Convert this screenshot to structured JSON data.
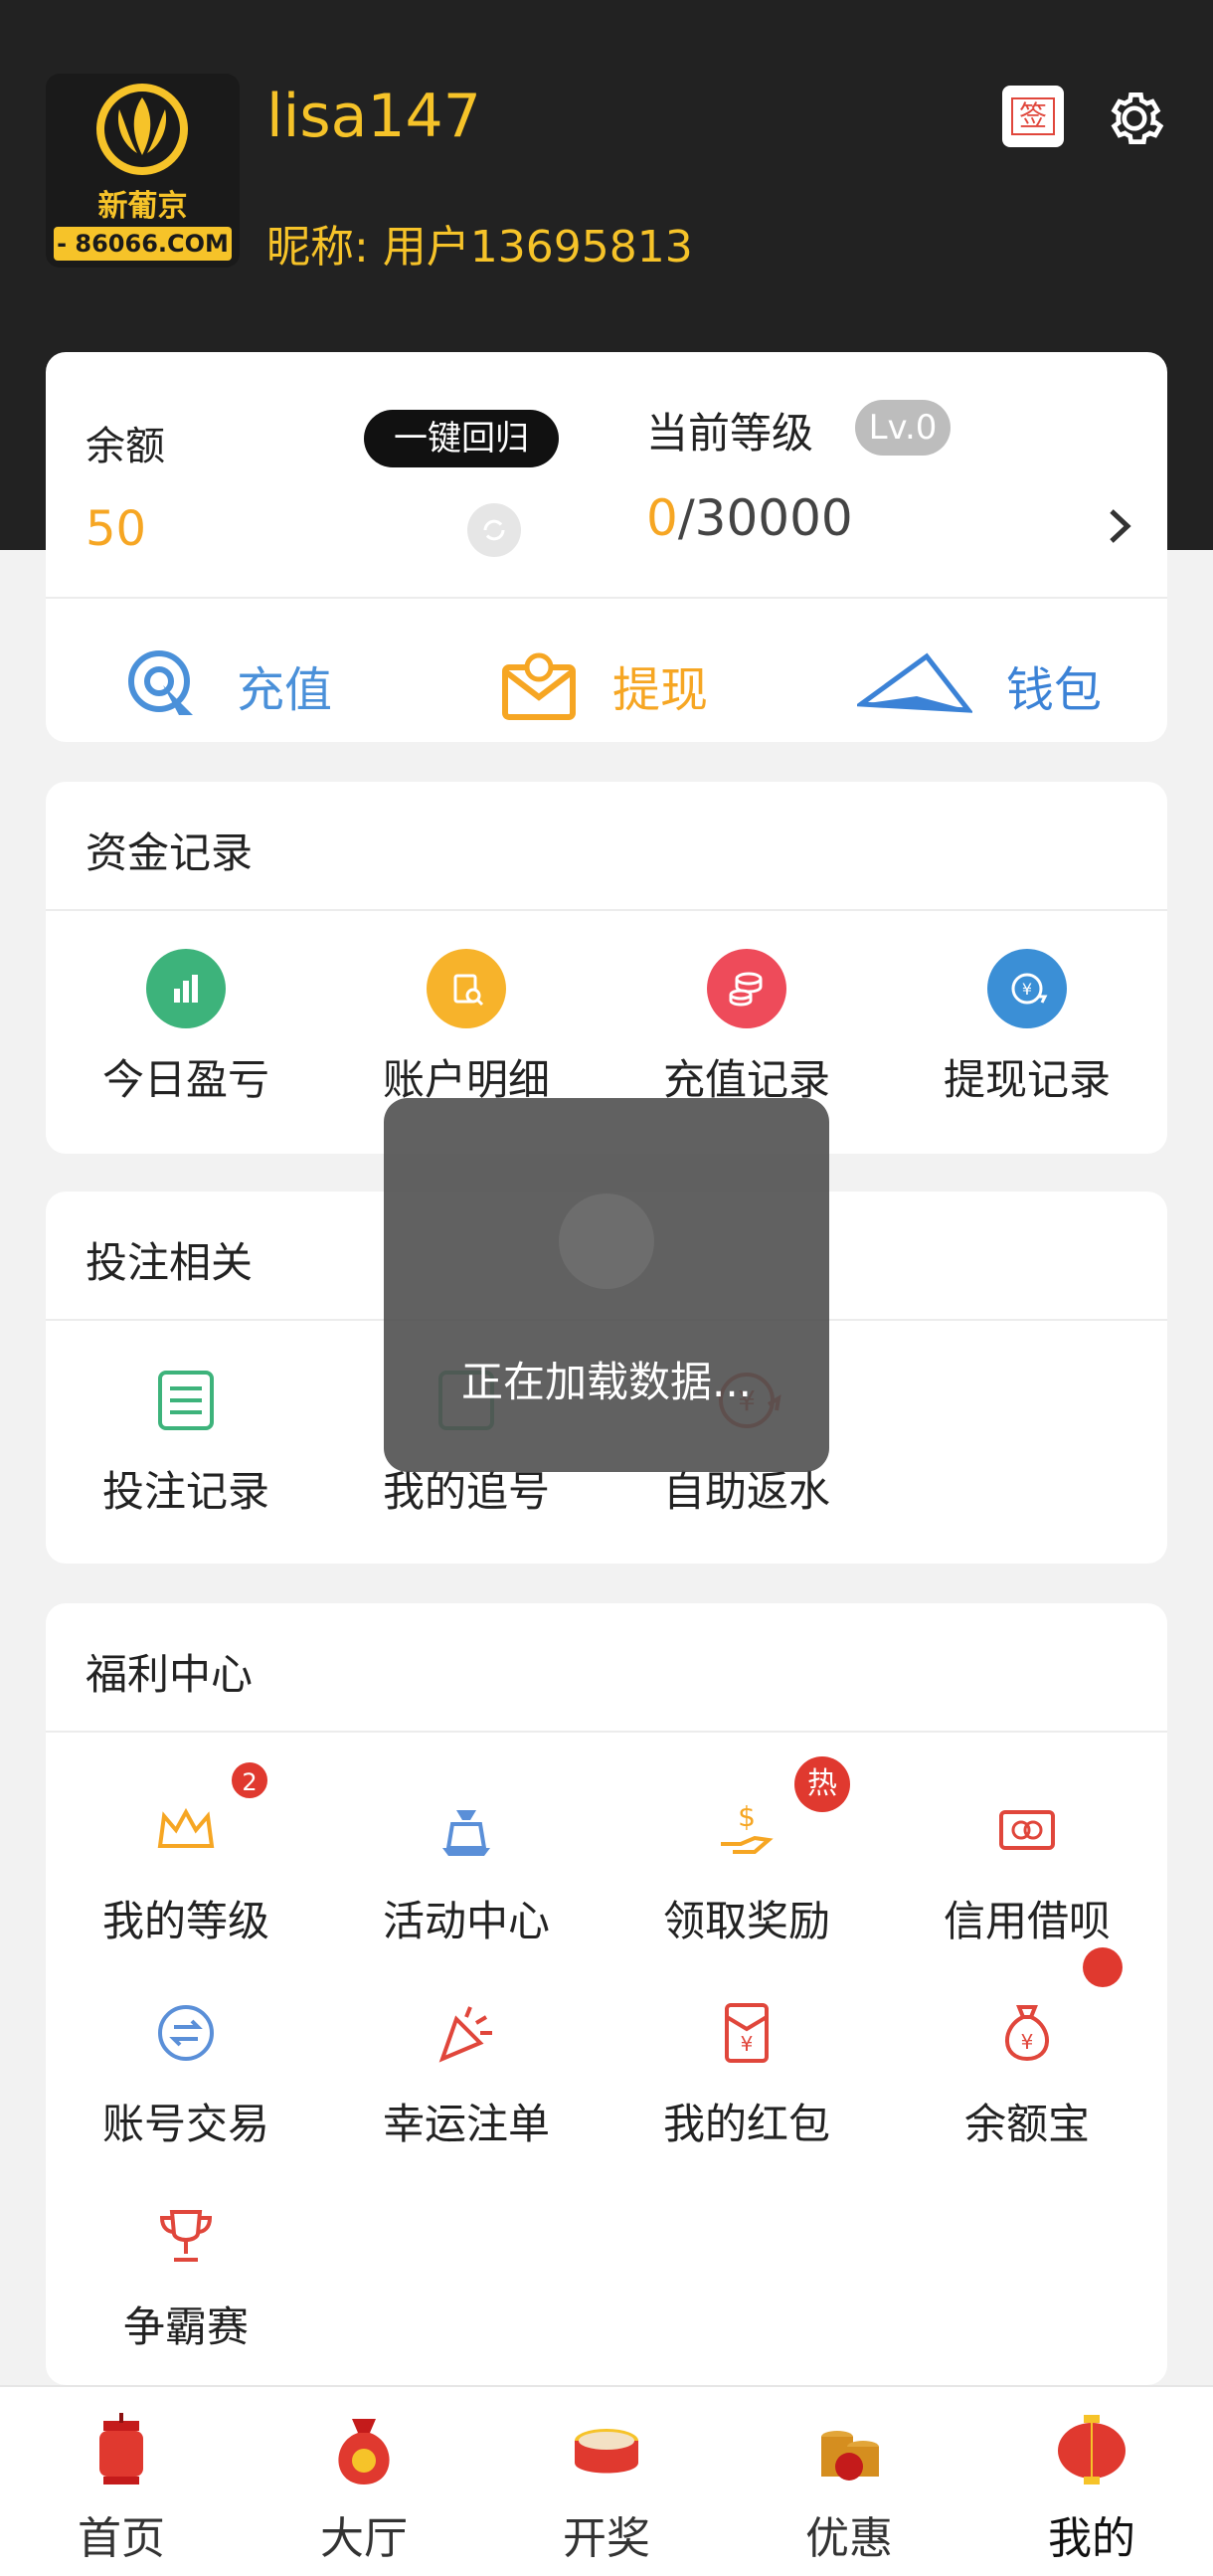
{
  "header": {
    "logo_text": "新葡京",
    "logo_url_text": "- 86066.COM -",
    "username": "lisa147",
    "nickname": "昵称: 用户13695813",
    "sign_label": "签"
  },
  "account": {
    "balance_label": "余额",
    "balance_value": "50",
    "one_key_label": "一键回归",
    "level_label": "当前等级",
    "level_badge": "Lv.0",
    "level_current": "0",
    "level_target": "/30000"
  },
  "actions": [
    {
      "label": "充值",
      "icon": "recharge-icon",
      "color": "#4a90d9"
    },
    {
      "label": "提现",
      "icon": "withdraw-icon",
      "color": "#f6a623"
    },
    {
      "label": "钱包",
      "icon": "wallet-icon",
      "color": "#3b82d6"
    }
  ],
  "funds": {
    "title": "资金记录",
    "items": [
      {
        "label": "今日盈亏",
        "icon": "chart-icon",
        "color": "#3db37b"
      },
      {
        "label": "账户明细",
        "icon": "document-search-icon",
        "color": "#f7b32b"
      },
      {
        "label": "充值记录",
        "icon": "coins-icon",
        "color": "#ee4b5a"
      },
      {
        "label": "提现记录",
        "icon": "yen-exchange-icon",
        "color": "#3b8fd6"
      }
    ]
  },
  "betting": {
    "title": "投注相关",
    "items": [
      {
        "label": "投注记录",
        "icon": "list-icon"
      },
      {
        "label": "我的追号",
        "icon": "tracking-icon"
      },
      {
        "label": "自助返水",
        "icon": "rebate-icon"
      }
    ]
  },
  "welfare": {
    "title": "福利中心",
    "items": [
      {
        "label": "我的等级",
        "icon": "crown-icon",
        "badge": "2"
      },
      {
        "label": "活动中心",
        "icon": "gift-bag-icon"
      },
      {
        "label": "领取奖励",
        "icon": "reward-hand-icon",
        "badge": "热"
      },
      {
        "label": "信用借呗",
        "icon": "credit-card-icon"
      },
      {
        "label": "账号交易",
        "icon": "exchange-icon"
      },
      {
        "label": "幸运注单",
        "icon": "party-popper-icon"
      },
      {
        "label": "我的红包",
        "icon": "red-envelope-icon"
      },
      {
        "label": "余额宝",
        "icon": "money-bag-icon"
      },
      {
        "label": "争霸赛",
        "icon": "trophy-icon"
      }
    ]
  },
  "loading": {
    "text": "正在加载数据..."
  },
  "tabbar": [
    {
      "label": "首页",
      "icon": "lantern-icon",
      "active": false
    },
    {
      "label": "大厅",
      "icon": "fortune-bag-icon",
      "active": false
    },
    {
      "label": "开奖",
      "icon": "drum-icon",
      "active": false
    },
    {
      "label": "优惠",
      "icon": "coin-stack-icon",
      "active": false
    },
    {
      "label": "我的",
      "icon": "red-lantern-icon",
      "active": true
    }
  ]
}
